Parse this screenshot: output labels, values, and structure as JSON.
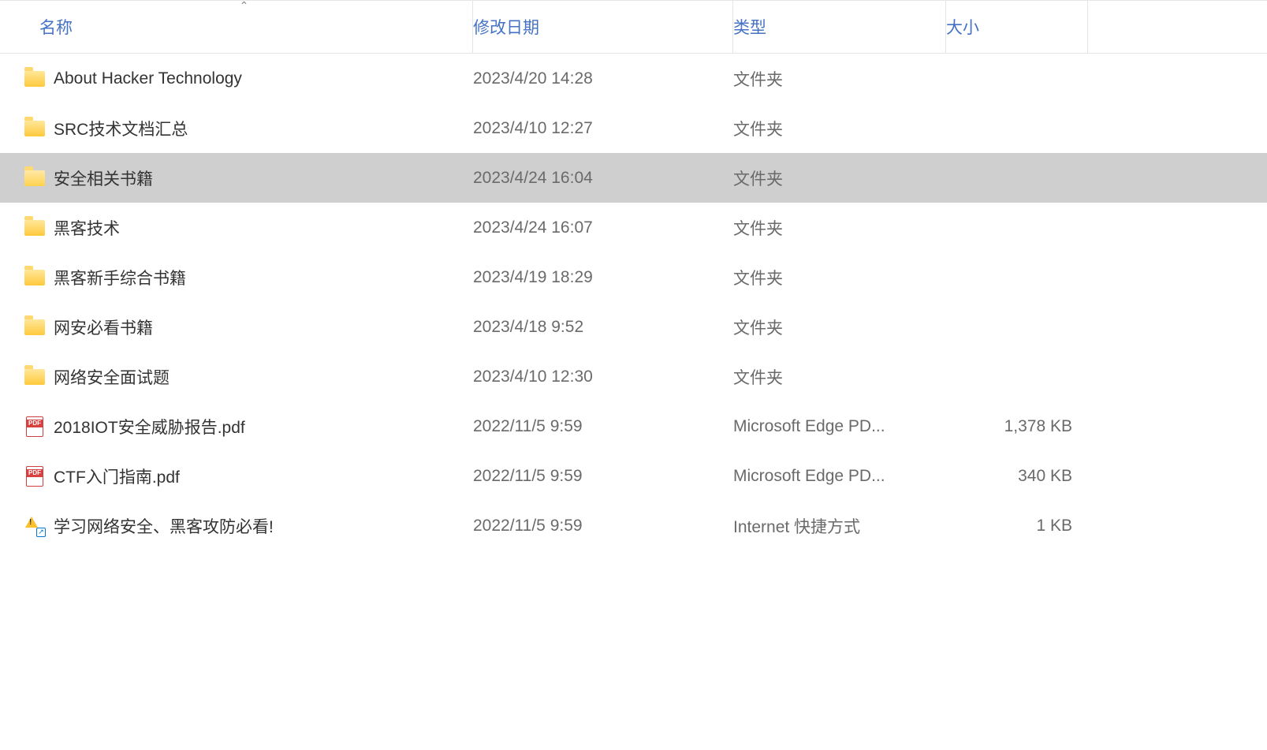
{
  "headers": {
    "name": "名称",
    "date": "修改日期",
    "type": "类型",
    "size": "大小"
  },
  "sort": {
    "column": "name",
    "direction": "asc",
    "glyph": "⌃"
  },
  "items": [
    {
      "icon": "folder",
      "name": "About Hacker Technology",
      "date": "2023/4/20 14:28",
      "type": "文件夹",
      "size": "",
      "selected": false
    },
    {
      "icon": "folder",
      "name": "SRC技术文档汇总",
      "date": "2023/4/10 12:27",
      "type": "文件夹",
      "size": "",
      "selected": false
    },
    {
      "icon": "folder-open",
      "name": "安全相关书籍",
      "date": "2023/4/24 16:04",
      "type": "文件夹",
      "size": "",
      "selected": true
    },
    {
      "icon": "folder",
      "name": "黑客技术",
      "date": "2023/4/24 16:07",
      "type": "文件夹",
      "size": "",
      "selected": false
    },
    {
      "icon": "folder",
      "name": "黑客新手综合书籍",
      "date": "2023/4/19 18:29",
      "type": "文件夹",
      "size": "",
      "selected": false
    },
    {
      "icon": "folder",
      "name": "网安必看书籍",
      "date": "2023/4/18 9:52",
      "type": "文件夹",
      "size": "",
      "selected": false
    },
    {
      "icon": "folder",
      "name": "网络安全面试题",
      "date": "2023/4/10 12:30",
      "type": "文件夹",
      "size": "",
      "selected": false
    },
    {
      "icon": "pdf",
      "name": "2018IOT安全威胁报告.pdf",
      "date": "2022/11/5 9:59",
      "type": "Microsoft Edge PD...",
      "size": "1,378 KB",
      "selected": false
    },
    {
      "icon": "pdf",
      "name": "CTF入门指南.pdf",
      "date": "2022/11/5 9:59",
      "type": "Microsoft Edge PD...",
      "size": "340 KB",
      "selected": false
    },
    {
      "icon": "url",
      "name": "学习网络安全、黑客攻防必看!",
      "date": "2022/11/5 9:59",
      "type": "Internet 快捷方式",
      "size": "1 KB",
      "selected": false
    }
  ]
}
